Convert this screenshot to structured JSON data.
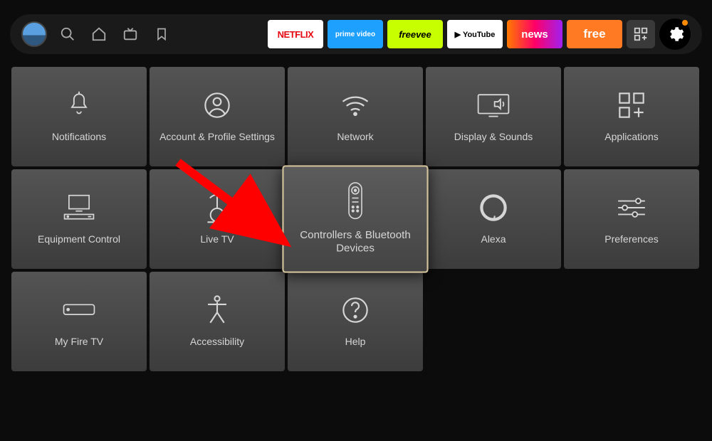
{
  "topbar": {
    "apps": {
      "netflix": "NETFLIX",
      "primevideo": "prime video",
      "freevee": "freevee",
      "youtube": "▶ YouTube",
      "news": "news",
      "free": "free"
    }
  },
  "settings_tiles": [
    {
      "icon": "bell-icon",
      "label": "Notifications"
    },
    {
      "icon": "account-icon",
      "label": "Account & Profile Settings"
    },
    {
      "icon": "wifi-icon",
      "label": "Network"
    },
    {
      "icon": "display-icon",
      "label": "Display & Sounds"
    },
    {
      "icon": "apps-icon",
      "label": "Applications"
    },
    {
      "icon": "equipment-icon",
      "label": "Equipment Control"
    },
    {
      "icon": "livetv-icon",
      "label": "Live TV"
    },
    {
      "icon": "remote-icon",
      "label": "Controllers & Bluetooth Devices",
      "selected": true
    },
    {
      "icon": "alexa-icon",
      "label": "Alexa"
    },
    {
      "icon": "preferences-icon",
      "label": "Preferences"
    },
    {
      "icon": "firetv-icon",
      "label": "My Fire TV"
    },
    {
      "icon": "accessibility-icon",
      "label": "Accessibility"
    },
    {
      "icon": "help-icon",
      "label": "Help"
    }
  ],
  "annotation": {
    "color": "#ff0000"
  }
}
